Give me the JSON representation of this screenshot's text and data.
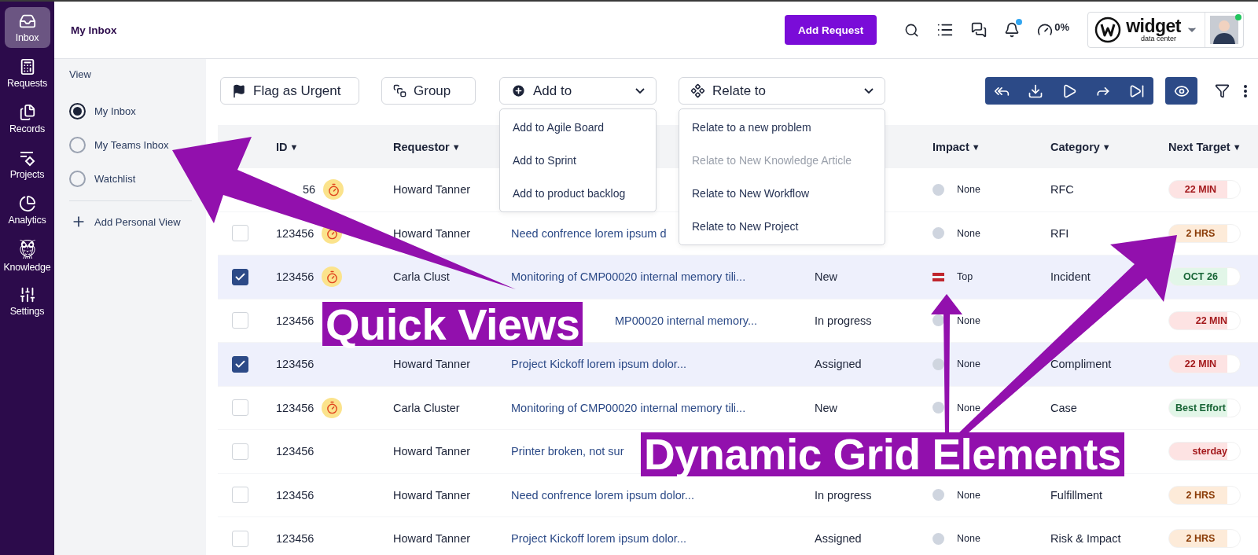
{
  "nav": [
    {
      "label": "Inbox",
      "selected": true
    },
    {
      "label": "Requests",
      "selected": false
    },
    {
      "label": "Records",
      "selected": false
    },
    {
      "label": "Projects",
      "selected": false
    },
    {
      "label": "Analytics",
      "selected": false
    },
    {
      "label": "Knowledge",
      "selected": false
    },
    {
      "label": "Settings",
      "selected": false
    }
  ],
  "header": {
    "title": "My Inbox",
    "add_button": "Add Request",
    "bell_unread": true,
    "progress": "0%",
    "logo": {
      "name": "widget",
      "tagline": "data center"
    },
    "avatar_online": true
  },
  "views": {
    "heading": "View",
    "items": [
      {
        "label": "My Inbox",
        "selected": true
      },
      {
        "label": "My Teams Inbox",
        "selected": false
      },
      {
        "label": "Watchlist",
        "selected": false
      }
    ],
    "add": "Add Personal View"
  },
  "toolbar": {
    "flag": "Flag as Urgent",
    "group": "Group",
    "add_to": {
      "label": "Add to",
      "expanded": true,
      "items": [
        {
          "label": "Add to Agile Board",
          "disabled": false
        },
        {
          "label": "Add to Sprint",
          "disabled": false
        },
        {
          "label": "Add to product backlog",
          "disabled": false
        }
      ]
    },
    "relate_to": {
      "label": "Relate to",
      "expanded": true,
      "items": [
        {
          "label": "Relate to a new problem",
          "disabled": false
        },
        {
          "label": "Relate to New Knowledge Article",
          "disabled": true
        },
        {
          "label": "Relate to New Workflow",
          "disabled": false
        },
        {
          "label": "Relate to New Project",
          "disabled": false
        }
      ]
    }
  },
  "table": {
    "columns": {
      "id": {
        "label": "ID",
        "sort_glyph": "▼"
      },
      "requestor": {
        "label": "Requestor",
        "sort_glyph": "▼"
      },
      "impact": {
        "label": "Impact",
        "sort_glyph": "▼"
      },
      "category": {
        "label": "Category",
        "sort_glyph": "▼"
      },
      "next_target": {
        "label": "Next Target",
        "sort_glyph": "▼"
      }
    },
    "rows": [
      {
        "id": "56",
        "arrow_over": true,
        "timer": true,
        "requestor": "Howard Tanner",
        "impact": {
          "kind": "none",
          "label": "None"
        },
        "category": "RFC",
        "target": {
          "kind": "urgent",
          "label": "22 MIN"
        }
      },
      {
        "checked": false,
        "id": "123456",
        "timer": true,
        "requestor": "Howard Tanner",
        "subject": "Need confrence lorem ipsum d",
        "impact": {
          "kind": "none",
          "label": "None"
        },
        "category": "RFI",
        "target": {
          "kind": "soon",
          "label": "2 HRS"
        }
      },
      {
        "checked": true,
        "id": "123456",
        "timer": true,
        "requestor": "Carla Clust",
        "subject": "Monitoring of CMP00020 internal memory tili...",
        "status": "New",
        "impact": {
          "kind": "top",
          "label": "Top"
        },
        "category": "Incident",
        "target": {
          "kind": "ok",
          "label": "OCT 26"
        }
      },
      {
        "checked": false,
        "id": "123456",
        "timer": false,
        "caption_over": true,
        "subject": "MP00020 internal memory...",
        "status": "In progress",
        "impact": {
          "kind": "none",
          "label": "None"
        },
        "target": {
          "kind": "urgent",
          "label": "22 MIN"
        }
      },
      {
        "checked": true,
        "id": "123456",
        "timer": false,
        "requestor": "Howard Tanner",
        "subject": "Project Kickoff lorem ipsum dolor...",
        "status": "Assigned",
        "impact": {
          "kind": "none",
          "label": "None"
        },
        "category": "Compliment",
        "target": {
          "kind": "urgent",
          "label": "22 MIN"
        }
      },
      {
        "checked": false,
        "id": "123456",
        "timer": true,
        "requestor": "Carla Cluster",
        "subject": "Monitoring of CMP00020 internal memory tili...",
        "status": "New",
        "impact": {
          "kind": "none",
          "label": "None"
        },
        "category": "Case",
        "target": {
          "kind": "ok",
          "label": "Best Effort"
        }
      },
      {
        "checked": false,
        "id": "123456",
        "timer": false,
        "caption_over": true,
        "requestor": "Howard Tanner",
        "subject": "Printer broken, not sur",
        "target": {
          "kind": "urgent",
          "label": "sterday"
        }
      },
      {
        "checked": false,
        "id": "123456",
        "timer": false,
        "requestor": "Howard Tanner",
        "subject": "Need confrence lorem ipsum dolor...",
        "status": "In progress",
        "impact": {
          "kind": "none",
          "label": "None"
        },
        "category": "Fulfillment",
        "target": {
          "kind": "soon",
          "label": "2 HRS"
        }
      },
      {
        "checked": false,
        "id": "123456",
        "timer": false,
        "requestor": "Howard Tanner",
        "subject": "Project Kickoff lorem ipsum dolor...",
        "status": "Assigned",
        "impact": {
          "kind": "none",
          "label": "None"
        },
        "category": "Risk & Impact",
        "target": {
          "kind": "soon",
          "label": "2 HRS"
        }
      }
    ]
  },
  "annotations": [
    {
      "text": "Quick Views"
    },
    {
      "text": "Dynamic Grid Elements"
    }
  ]
}
